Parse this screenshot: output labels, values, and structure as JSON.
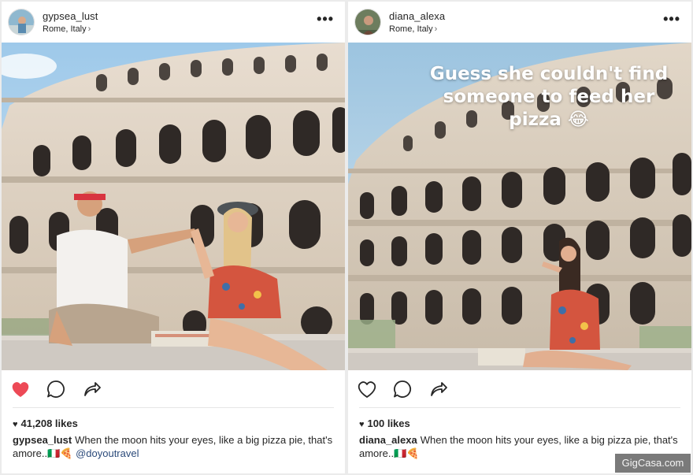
{
  "posts": [
    {
      "username": "gypsea_lust",
      "location": "Rome, Italy",
      "location_chevron": "›",
      "more": "•••",
      "liked": true,
      "likes": "41,208 likes",
      "caption_user": "gypsea_lust",
      "caption_text": "When the moon hits your eyes, like a big pizza pie, that's amore..🇮🇹🍕",
      "caption_mention": "@doyoutravel"
    },
    {
      "username": "diana_alexa",
      "location": "Rome, Italy",
      "location_chevron": "›",
      "more": "•••",
      "liked": false,
      "likes": "100 likes",
      "caption_user": "diana_alexa",
      "caption_text": "When the moon hits your eyes, like a big pizza pie, that's amore..🇮🇹🍕",
      "photo_overlay_text": "Guess she couldn't find someone to feed her pizza 😂"
    }
  ],
  "watermark": "GigCasa.com",
  "colors": {
    "like_red": "#ed4956",
    "text": "#262626",
    "mention_blue": "#2b4a7a"
  },
  "icons": [
    "heart-icon",
    "comment-icon",
    "share-icon",
    "more-icon",
    "chevron-right-icon"
  ]
}
